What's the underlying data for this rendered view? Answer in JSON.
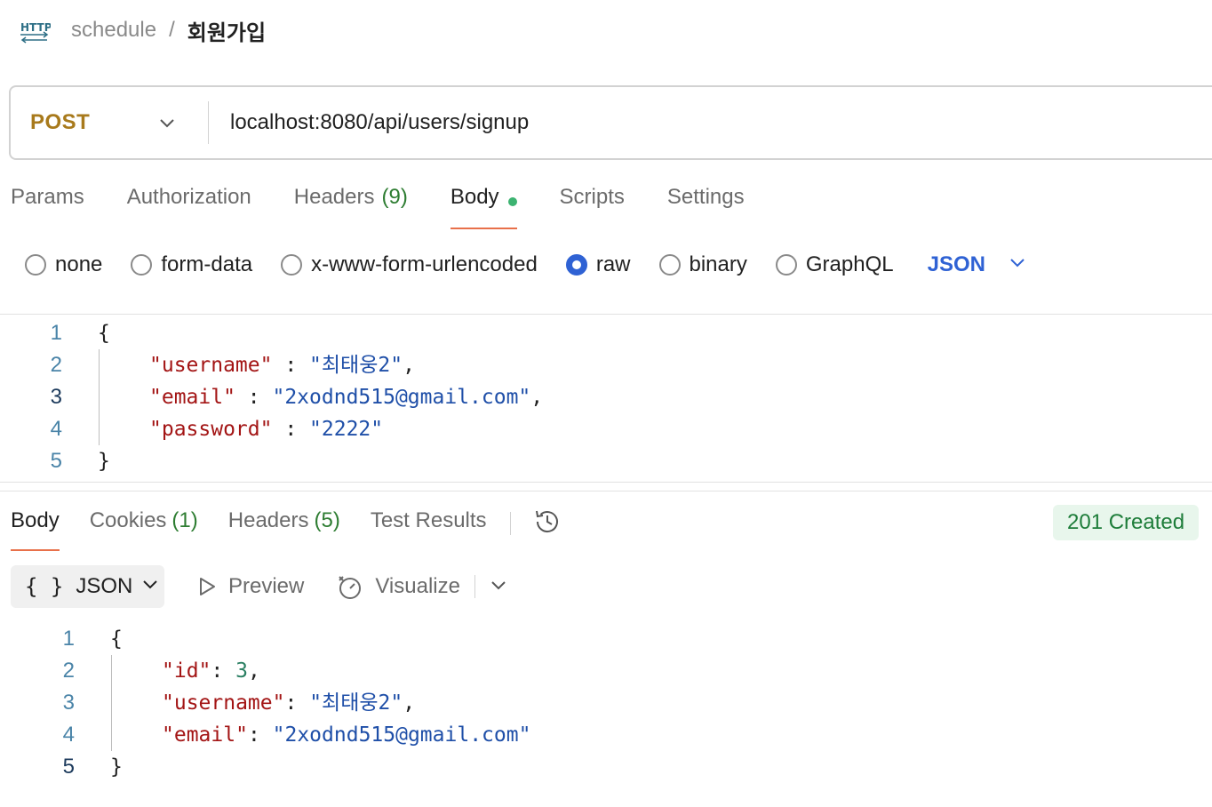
{
  "breadcrumb": {
    "icon": "http-icon",
    "collection": "schedule",
    "separator": "/",
    "request_name": "회원가입"
  },
  "request": {
    "method": "POST",
    "url": "localhost:8080/api/users/signup"
  },
  "request_tabs": [
    {
      "label": "Params",
      "count": ""
    },
    {
      "label": "Authorization",
      "count": ""
    },
    {
      "label": "Headers",
      "count": "(9)"
    },
    {
      "label": "Body",
      "count": "",
      "active": true,
      "has_dot": true
    },
    {
      "label": "Scripts",
      "count": ""
    },
    {
      "label": "Settings",
      "count": ""
    }
  ],
  "body_types": [
    "none",
    "form-data",
    "x-www-form-urlencoded",
    "raw",
    "binary",
    "GraphQL"
  ],
  "body_type_selected": "raw",
  "body_format": "JSON",
  "request_body": {
    "line_numbers": [
      "1",
      "2",
      "3",
      "4",
      "5"
    ],
    "open_brace": "{",
    "close_brace": "}",
    "fields": [
      {
        "key": "\"username\"",
        "sep": " : ",
        "value": "\"최태웅2\"",
        "trail": ","
      },
      {
        "key": "\"email\"",
        "sep": " : ",
        "value": "\"2xodnd515@gmail.com\"",
        "trail": ","
      },
      {
        "key": "\"password\"",
        "sep": " : ",
        "value": "\"2222\"",
        "trail": ""
      }
    ]
  },
  "response_tabs": [
    {
      "label": "Body",
      "count": "",
      "active": true
    },
    {
      "label": "Cookies",
      "count": "(1)"
    },
    {
      "label": "Headers",
      "count": "(5)"
    },
    {
      "label": "Test Results",
      "count": ""
    }
  ],
  "status": {
    "text": "201 Created",
    "color": "#1e7d3a",
    "bg": "#e8f6ec"
  },
  "response_toolbar": {
    "format_braces": "{ }",
    "format_label": "JSON",
    "preview_label": "Preview",
    "visualize_label": "Visualize"
  },
  "response_body": {
    "line_numbers": [
      "1",
      "2",
      "3",
      "4",
      "5"
    ],
    "open_brace": "{",
    "close_brace": "}",
    "fields": [
      {
        "key": "\"id\"",
        "sep": ": ",
        "value": "3",
        "value_type": "number",
        "trail": ","
      },
      {
        "key": "\"username\"",
        "sep": ": ",
        "value": "\"최태웅2\"",
        "value_type": "string",
        "trail": ","
      },
      {
        "key": "\"email\"",
        "sep": ": ",
        "value": "\"2xodnd515@gmail.com\"",
        "value_type": "string",
        "trail": ""
      }
    ]
  },
  "colors": {
    "method": "#a87a1c",
    "accent_tab_underline": "#e8704a",
    "link_blue": "#2f62d4",
    "json_key": "#a31515",
    "json_string": "#1f4fa8",
    "json_number": "#2a7f62"
  }
}
